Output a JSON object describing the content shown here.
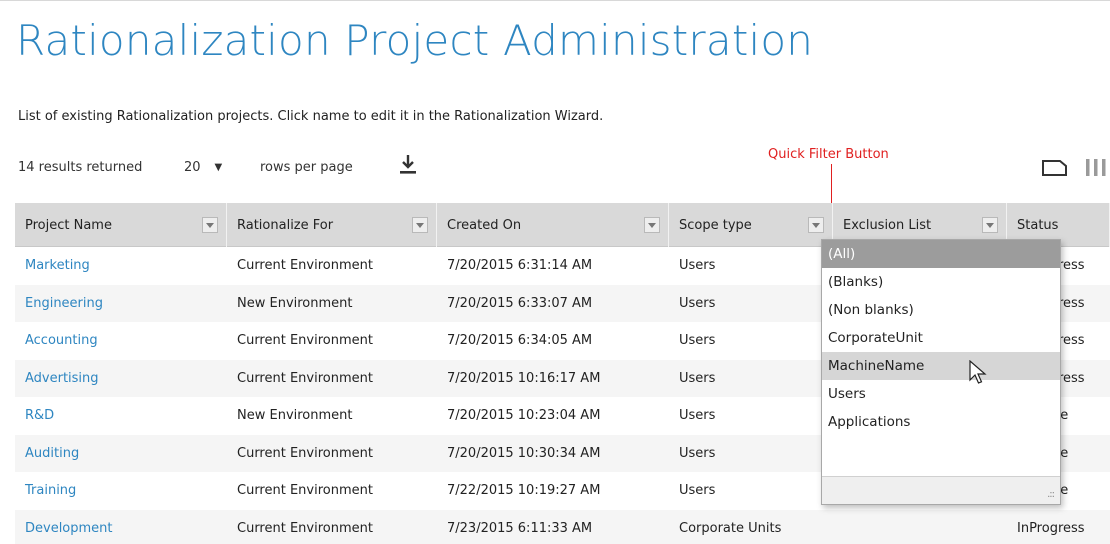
{
  "header": {
    "title": "Rationalization Project Administration",
    "subtitle": "List of existing Rationalization projects. Click name to edit it in the Rationalization Wizard."
  },
  "toolbar": {
    "results_text": "14 results returned",
    "rows_per_page_value": "20",
    "rows_per_page_label": "rows per page",
    "download_icon": "download-icon"
  },
  "annotation": {
    "label": "Quick Filter Button",
    "color": "#e02020"
  },
  "grid": {
    "columns": [
      {
        "label": "Project Name"
      },
      {
        "label": "Rationalize For"
      },
      {
        "label": "Created On"
      },
      {
        "label": "Scope type"
      },
      {
        "label": "Exclusion List"
      },
      {
        "label": "Status"
      }
    ],
    "rows": [
      {
        "name": "Marketing",
        "rationalize_for": "Current Environment",
        "created_on": "7/20/2015 6:31:14 AM",
        "scope": "Users",
        "exclusion": "",
        "status": "InProgress"
      },
      {
        "name": "Engineering",
        "rationalize_for": "New Environment",
        "created_on": "7/20/2015 6:33:07 AM",
        "scope": "Users",
        "exclusion": "",
        "status": "InProgress"
      },
      {
        "name": "Accounting",
        "rationalize_for": "Current Environment",
        "created_on": "7/20/2015 6:34:05 AM",
        "scope": "Users",
        "exclusion": "",
        "status": "InProgress"
      },
      {
        "name": "Advertising",
        "rationalize_for": "Current Environment",
        "created_on": "7/20/2015 10:16:17 AM",
        "scope": "Users",
        "exclusion": "",
        "status": "InProgress"
      },
      {
        "name": "R&D",
        "rationalize_for": "New Environment",
        "created_on": "7/20/2015 10:23:04 AM",
        "scope": "Users",
        "exclusion": "",
        "status": "Analyze"
      },
      {
        "name": "Auditing",
        "rationalize_for": "Current Environment",
        "created_on": "7/20/2015 10:30:34 AM",
        "scope": "Users",
        "exclusion": "",
        "status": "Analyze"
      },
      {
        "name": "Training",
        "rationalize_for": "Current Environment",
        "created_on": "7/22/2015 10:19:27 AM",
        "scope": "Users",
        "exclusion": "",
        "status": "Analyze"
      },
      {
        "name": "Development",
        "rationalize_for": "Current Environment",
        "created_on": "7/23/2015 6:11:33 AM",
        "scope": "Corporate Units",
        "exclusion": "",
        "status": "InProgress"
      }
    ]
  },
  "filter_popup": {
    "options": [
      "(All)",
      "(Blanks)",
      "(Non blanks)",
      "CorporateUnit",
      "MachineName",
      "Users",
      "Applications"
    ],
    "selected": "(All)",
    "hovered": "MachineName"
  },
  "colors": {
    "accent": "#2e86c1",
    "header_bg": "#d9d9d9",
    "selected_option_bg": "#9c9c9c"
  }
}
